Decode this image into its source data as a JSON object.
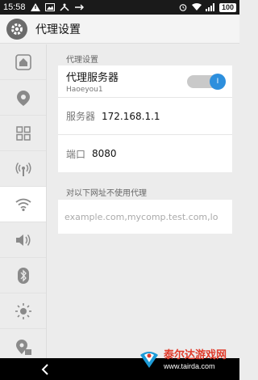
{
  "statusbar": {
    "time": "15:58",
    "battery": "100"
  },
  "header": {
    "title": "代理设置"
  },
  "sidebar": {
    "items": [
      {
        "icon": "home-icon"
      },
      {
        "icon": "location-pin-icon"
      },
      {
        "icon": "grid-icon"
      },
      {
        "icon": "wireless-signal-icon"
      },
      {
        "icon": "wifi-icon"
      },
      {
        "icon": "volume-icon"
      },
      {
        "icon": "bluetooth-icon"
      },
      {
        "icon": "brightness-icon"
      },
      {
        "icon": "location-lock-icon"
      }
    ],
    "active_index": 4
  },
  "proxy": {
    "section_label": "代理设置",
    "title": "代理服务器",
    "subtitle": "Haoeyou1",
    "toggle_on": true,
    "toggle_knob_text": "I",
    "server_label": "服务器",
    "server_value": "172.168.1.1",
    "port_label": "端口",
    "port_value": "8080"
  },
  "exclusion": {
    "section_label": "对以下网址不使用代理",
    "placeholder": "example.com,mycomp.test.com,lo"
  },
  "watermark": {
    "brand": "泰尔达游戏网",
    "url": "www.tairda.com"
  }
}
